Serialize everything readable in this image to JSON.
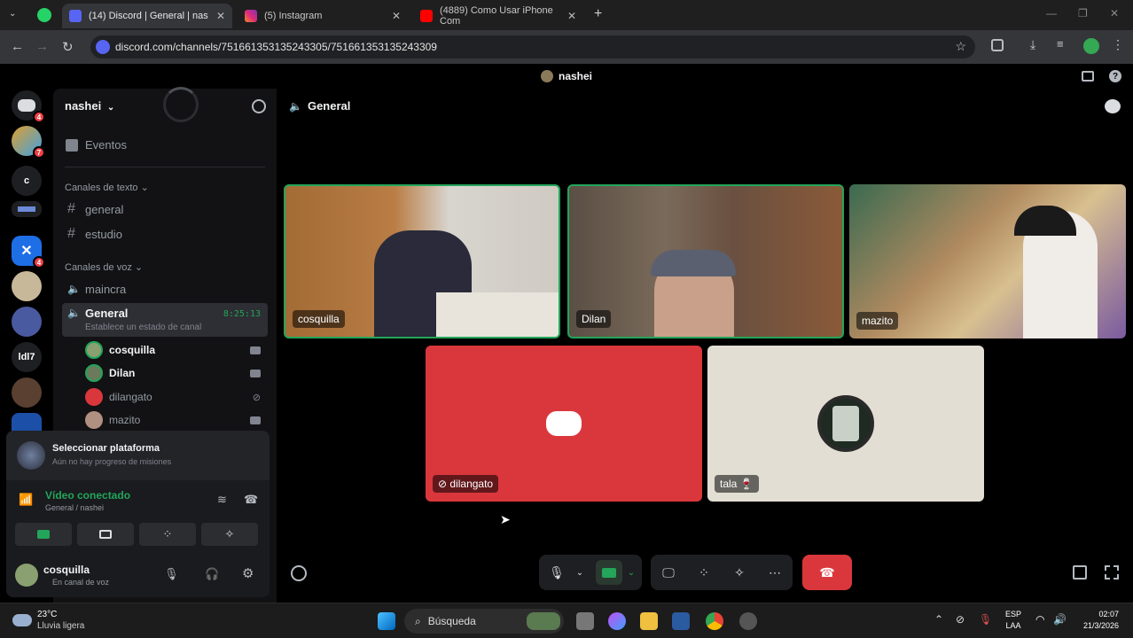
{
  "browser": {
    "tabs": [
      {
        "label": "(14) Discord | General | nas"
      },
      {
        "label": "(5) Instagram"
      },
      {
        "label": "(4889) Como Usar iPhone Com"
      }
    ],
    "new_tab": "+",
    "url": "discord.com/channels/751661353135243305/751661353135243309"
  },
  "discord": {
    "top_title": "nashei",
    "server_name": "nashei",
    "events_label": "Eventos",
    "text_category": "Canales de texto",
    "text_channels": [
      "general",
      "estudio"
    ],
    "voice_category": "Canales de voz",
    "voice_channels": [
      "maincra"
    ],
    "active_voice": {
      "name": "General",
      "timer": "8:25:13",
      "status": "Establece un estado de canal"
    },
    "voice_members": [
      "cosquilla",
      "Dilan",
      "dilangato",
      "mazito"
    ],
    "guild_labels": [
      "c",
      "ldl7"
    ],
    "guild_badges": [
      "4",
      "7",
      "4"
    ],
    "platform": {
      "title": "Seleccionar plataforma",
      "subtitle": "Aún no hay progreso de misiones"
    },
    "connection": {
      "title": "Vídeo conectado",
      "subtitle": "General / nashei"
    },
    "user": {
      "name": "cosquilla",
      "status": "En canal de voz"
    },
    "stage_channel": "General",
    "tiles": [
      {
        "name": "cosquilla"
      },
      {
        "name": "Dilan"
      },
      {
        "name": "mazito"
      },
      {
        "name": "dilangato"
      },
      {
        "name": "tala 🍷"
      }
    ]
  },
  "taskbar": {
    "weather_temp": "23°C",
    "weather_desc": "Lluvia ligera",
    "search": "Búsqueda",
    "lang": "ESP",
    "lang2": "LAA",
    "time": "02:07",
    "date": "21/3/2026"
  },
  "colors": {
    "accent": "#23a55a",
    "danger": "#da373c",
    "blurple": "#5865f2"
  }
}
